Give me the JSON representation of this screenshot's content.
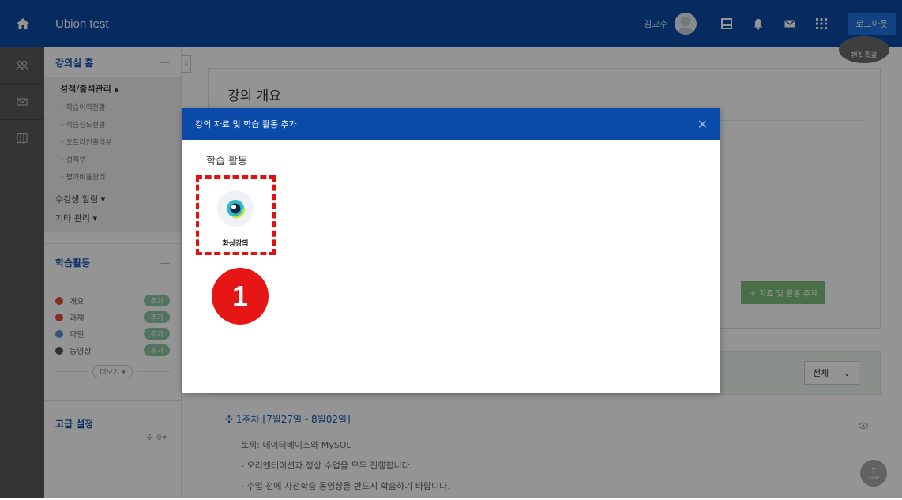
{
  "topbar": {
    "title": "Ubion test",
    "user_name": "김교수",
    "logout_label": "로그아웃"
  },
  "sidebar": {
    "home_label": "강의실 홈",
    "group_title": "성적/출석관리 ▴",
    "group_items": [
      "· 학습이력현황",
      "· 학습진도현황",
      "· 오프라인출석부",
      "· 성적부",
      "· 평가비율관리"
    ],
    "notify_label": "수강생 알림 ▾",
    "other_label": "기타 관리 ▾",
    "activity_title": "학습활동",
    "activities": [
      {
        "label": "개요",
        "add": "추가",
        "color": "#e0503c"
      },
      {
        "label": "과제",
        "add": "추가",
        "color": "#e0503c"
      },
      {
        "label": "파일",
        "add": "추가",
        "color": "#5a8fd8"
      },
      {
        "label": "동영상",
        "add": "추가",
        "color": "#555555"
      }
    ],
    "more_label": "더보기 ▾",
    "advanced_title": "고급 설정",
    "advanced_icons": "✣ ⚙▾"
  },
  "main": {
    "edit_label": "편집종료",
    "overview_title": "강의 개요",
    "add_resource_label": "＋ 자료 및 활동 추가",
    "week_select_value": "전체",
    "week_title": "✣ 1주차 [7월27일 - 8월02일]",
    "week_lines": [
      "토픽: 데이터베이스와 MySQL",
      "- 오리엔테이션과 정상 수업을 모두 진행합니다.",
      " - 수업 전에 사전학습 동영상을 반드시 학습하기 바랍니다."
    ],
    "top_label": "TOP"
  },
  "modal": {
    "title": "강의 자료 및 학습 활동 추가",
    "section_title": "학습 활동",
    "tile_label": "화상강의"
  },
  "annotation": {
    "step_number": "1"
  }
}
